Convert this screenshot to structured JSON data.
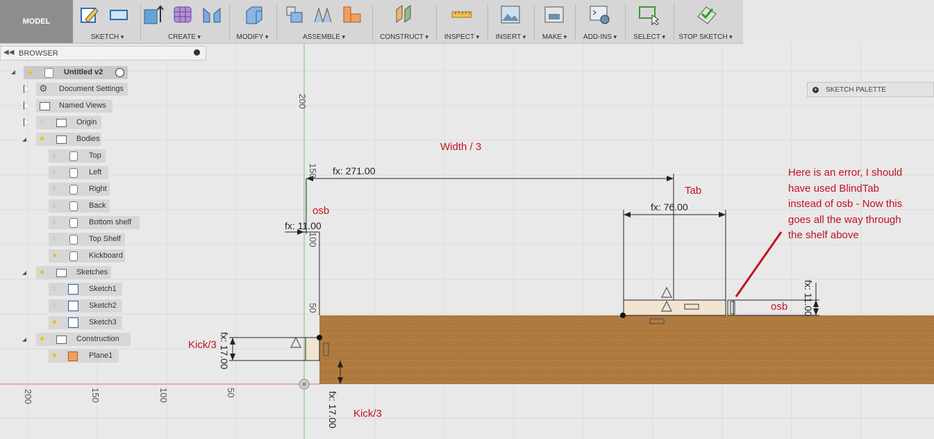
{
  "toolbar": {
    "model_label": "MODEL",
    "groups": [
      {
        "label": "SKETCH"
      },
      {
        "label": "CREATE"
      },
      {
        "label": "MODIFY"
      },
      {
        "label": "ASSEMBLE"
      },
      {
        "label": "CONSTRUCT"
      },
      {
        "label": "INSPECT"
      },
      {
        "label": "INSERT"
      },
      {
        "label": "MAKE"
      },
      {
        "label": "ADD-INS"
      },
      {
        "label": "SELECT"
      },
      {
        "label": "STOP SKETCH"
      }
    ]
  },
  "browser": {
    "title": "BROWSER",
    "root": "Untitled v2",
    "items": [
      {
        "label": "Document Settings"
      },
      {
        "label": "Named Views"
      },
      {
        "label": "Origin"
      },
      {
        "label": "Bodies"
      },
      {
        "label": "Top"
      },
      {
        "label": "Left"
      },
      {
        "label": "Right"
      },
      {
        "label": "Back"
      },
      {
        "label": "Bottom shelf"
      },
      {
        "label": "Top Shelf"
      },
      {
        "label": "Kickboard"
      },
      {
        "label": "Sketches"
      },
      {
        "label": "Sketch1"
      },
      {
        "label": "Sketch2"
      },
      {
        "label": "Sketch3"
      },
      {
        "label": "Construction"
      },
      {
        "label": "Plane1"
      }
    ]
  },
  "sketch_palette": {
    "label": "SKETCH PALETTE"
  },
  "canvas": {
    "ruler_vertical": [
      "200",
      "150",
      "100",
      "50"
    ],
    "ruler_horizontal": [
      "200",
      "150",
      "100",
      "50"
    ],
    "dimensions": {
      "width_dim": "fx: 271.00",
      "tab_dim": "fx: 76.00",
      "osb_left_dim": "fx: 11.00",
      "osb_right_dim": "fx: 11.00",
      "kick_left_dim": "fx: 17.00",
      "kick_bottom_dim": "fx: 17.00"
    },
    "annotations": {
      "width": "Width / 3",
      "tab": "Tab",
      "osb_top": "osb",
      "osb_right": "osb",
      "kick_left": "Kick/3",
      "kick_bottom": "Kick/3",
      "error_note": [
        "Here is an error, I should",
        "have used BlindTab",
        "instead of osb - Now this",
        "goes all the way through",
        "the shelf above"
      ]
    }
  },
  "colors": {
    "wood": "#b07a3f",
    "annotation": "#c1121f",
    "axis_green": "#7ccf7c",
    "axis_red": "#f08b8b"
  }
}
